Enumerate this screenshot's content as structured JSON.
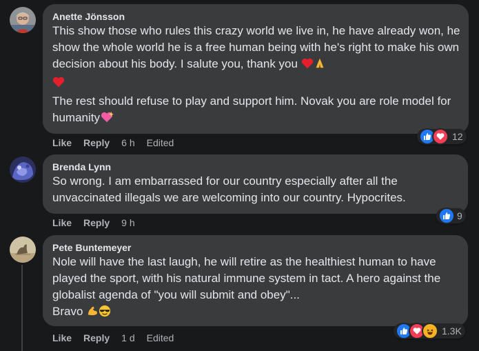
{
  "comments": [
    {
      "author": "Anette Jönsson",
      "text1": "This show those who rules this crazy world we live in, he have already won, he show the whole world he is a free human being with he's right to make his own decision about his body. I salute you, thank you ",
      "text2": "The rest should refuse to play and support him. Novak you are role model for humanity",
      "emojis": [
        "red-heart",
        "folded-hands",
        "red-heart",
        "sparkling-heart"
      ],
      "reactions": [
        "like",
        "love"
      ],
      "reaction_count": "12",
      "like_label": "Like",
      "reply_label": "Reply",
      "time": "6 h",
      "edited": "Edited"
    },
    {
      "author": "Brenda Lynn",
      "text": "So wrong. I am embarrassed for our country especially after all the unvaccinated illegals we are welcoming into our country. Hypocrites.",
      "reactions": [
        "like"
      ],
      "reaction_count": "9",
      "like_label": "Like",
      "reply_label": "Reply",
      "time": "9 h"
    },
    {
      "author": "Pete Buntemeyer",
      "text1": "Nole will have the last laugh, he will retire as the healthiest human to have played the sport, with his natural immune system in tact. A hero against the globalist agenda of \"you will submit and obey\"...",
      "text2": "Bravo ",
      "emojis": [
        "flexed-biceps",
        "smiling-face-with-sunglasses"
      ],
      "reactions": [
        "like",
        "love",
        "haha"
      ],
      "reaction_count": "1.3K",
      "like_label": "Like",
      "reply_label": "Reply",
      "time": "1 d",
      "edited": "Edited"
    }
  ],
  "colors": {
    "background": "#18191a",
    "bubble": "#3a3b3c",
    "like_blue": "#2078f4",
    "love_red": "#f33e58",
    "haha_yellow": "#f7b125",
    "secondary_text": "#b0b3b8"
  }
}
